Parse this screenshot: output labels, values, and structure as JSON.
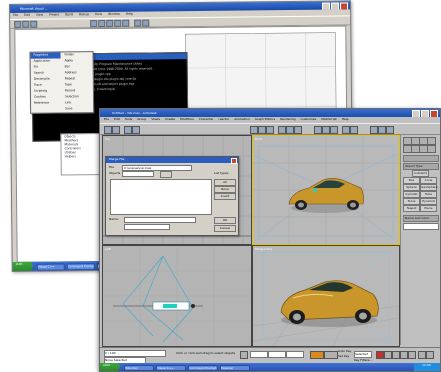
{
  "back_window": {
    "title": "Microsoft Visual ...",
    "menu": [
      "File",
      "Edit",
      "View",
      "Project",
      "Build",
      "Debug",
      "Tools",
      "Window",
      "Help"
    ],
    "dropdown_left": [
      "Fragment",
      "Application",
      "Fill",
      "Search",
      "Decompile",
      "Trace",
      "Scripting",
      "Confirm",
      "Reference"
    ],
    "dropdown_right": [
      "Folder",
      "Apply",
      "Bar",
      "Address",
      "Repeat",
      "Type",
      "Record",
      "Selection",
      "Link",
      "Save"
    ],
    "cmd_lines": [
      "Starting ...  Microsoft (R) Program Maintenance Utility",
      "Copyright (C) Microsoft Corp 1988-2000. All rights reserved.",
      "cl /nologo /c /O2 /W3 plugin.cpp",
      "link /nologo /dll /out:plugin.dlu plugin.obj core.lib",
      "Creating library plugin.lib and object plugin.exp",
      "plugin.dlu - 0 error(s), 0 warning(s)"
    ],
    "side_list": [
      "Objects",
      "Modifiers",
      "Materials",
      "Controllers",
      "Utilities",
      "Helpers"
    ],
    "taskbar": {
      "start": "start",
      "tasks": [
        "Visual C++",
        "Command Prompt",
        "Explorer"
      ]
    }
  },
  "front_window": {
    "title": "Untitled - 3ds max - Autodesk",
    "menu": [
      "File",
      "Edit",
      "Tools",
      "Group",
      "Views",
      "Create",
      "Modifiers",
      "Character",
      "reactor",
      "Animation",
      "Graph Editors",
      "Rendering",
      "Customize",
      "MAXScript",
      "Help"
    ],
    "viewports": {
      "top": "Top",
      "front": "Front",
      "left": "Left",
      "perspective": "Perspective"
    },
    "dialog": {
      "title": "Merge File",
      "label_file": "File",
      "file_value": "C:\\scenes\\car.max",
      "label_list": "Objects",
      "btn_ok": "OK",
      "btn_cancel": "Cancel",
      "btn_all": "All",
      "btn_none": "None",
      "btn_invert": "Invert",
      "filter_label": "List types",
      "bottom_label": "Name:"
    },
    "panel": {
      "object_type": "Object Type",
      "autogrid": "AutoGrid",
      "buttons": [
        "Box",
        "Cone",
        "Sphere",
        "GeoSphere",
        "Cylinder",
        "Tube",
        "Torus",
        "Pyramid",
        "Teapot",
        "Plane"
      ],
      "name_color": "Name and Color"
    },
    "status": {
      "selection": "None Selected",
      "prompt": "Click or click-and-drag to select objects",
      "frame": "0 / 100",
      "autokey": "Auto Key",
      "setkey": "Set Key",
      "selected": "Selected",
      "key_filters": "Key Filters..."
    },
    "taskbar": {
      "start": "start",
      "tasks": [
        "3ds max",
        "Visual C++",
        "Command Prompt",
        "Explorer"
      ],
      "clock": "12:00"
    }
  },
  "colors": {
    "car_body": "#c8962a",
    "title_blue": "#1c4eaa",
    "viewport_gray": "#b9b9b9",
    "active_border": "#e6c200"
  }
}
